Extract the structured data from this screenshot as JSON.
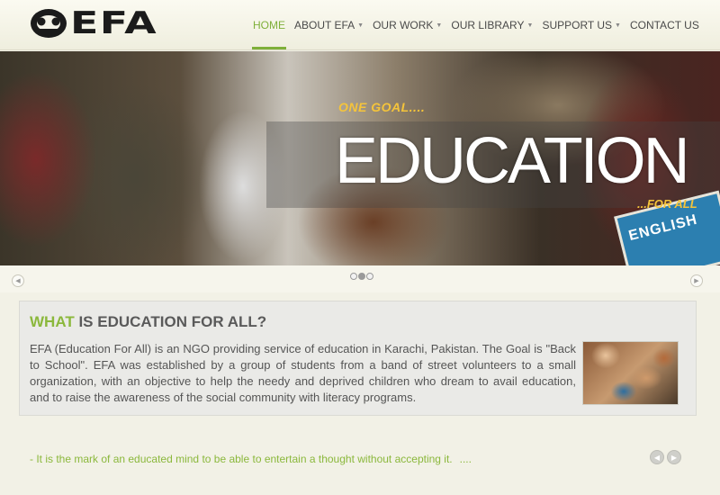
{
  "header": {
    "logo_text": "EFA",
    "nav": [
      {
        "label": "HOME",
        "has_caret": false,
        "active": true
      },
      {
        "label": "ABOUT EFA",
        "has_caret": true,
        "active": false
      },
      {
        "label": "OUR WORK",
        "has_caret": true,
        "active": false
      },
      {
        "label": "OUR LIBRARY",
        "has_caret": true,
        "active": false
      },
      {
        "label": "SUPPORT US",
        "has_caret": true,
        "active": false
      },
      {
        "label": "CONTACT US",
        "has_caret": false,
        "active": false
      }
    ]
  },
  "hero": {
    "tagline_top": "ONE GOAL....",
    "headline": "EDUCATION",
    "tagline_bottom": "...FOR ALL",
    "book_title": "ENGLISH",
    "slides": {
      "count": 3,
      "active_index": 1
    }
  },
  "content": {
    "title_accent": "WHAT",
    "title_rest": " IS EDUCATION FOR ALL?",
    "body": "EFA (Education For All) is an NGO providing service of education in Karachi, Pakistan. The Goal is \"Back to School\". EFA was established by a group of students from a band of street volunteers to a small organization, with an objective to help the needy and deprived children who dream to avail education, and to raise the awareness of the social community with literacy programs.",
    "photo_icon": "children-hands-photo"
  },
  "quote": {
    "prefix": "- ",
    "text": "It is the mark of an educated mind to be able to entertain a thought without accepting it.",
    "more": "...."
  },
  "colors": {
    "accent_green": "#8bb83c",
    "nav_active": "#7fb03a",
    "hero_tag_yellow": "#f5c43a"
  },
  "icons": {
    "slider_prev": "chevron-left-icon",
    "slider_next": "chevron-right-icon",
    "quote_prev": "arrow-left-icon",
    "quote_next": "arrow-right-icon"
  }
}
